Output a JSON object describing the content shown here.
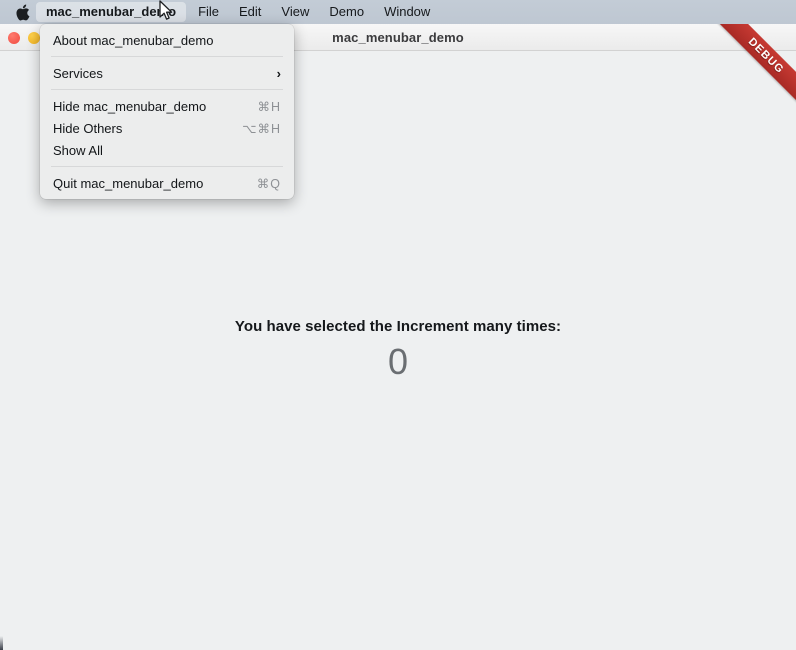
{
  "menubar": {
    "apple_icon": "apple-logo-icon",
    "app_name": "mac_menubar_demo",
    "items": [
      "File",
      "Edit",
      "View",
      "Demo",
      "Window"
    ]
  },
  "window": {
    "title": "mac_menubar_demo",
    "traffic_lights": [
      "close",
      "minimize",
      "zoom"
    ]
  },
  "debug_banner": {
    "label": "DEBUG",
    "color": "#b8322c"
  },
  "content": {
    "counter_label": "You have selected the Increment many times:",
    "counter_value": "0"
  },
  "app_menu": {
    "groups": [
      {
        "items": [
          {
            "label": "About mac_menubar_demo",
            "accel": "",
            "submenu": false
          }
        ]
      },
      {
        "items": [
          {
            "label": "Services",
            "accel": "",
            "submenu": true,
            "chevron": "›"
          }
        ]
      },
      {
        "items": [
          {
            "label": "Hide mac_menubar_demo",
            "accel": "⌘H",
            "submenu": false
          },
          {
            "label": "Hide Others",
            "accel": "⌥⌘H",
            "submenu": false
          },
          {
            "label": "Show All",
            "accel": "",
            "submenu": false
          }
        ]
      },
      {
        "items": [
          {
            "label": "Quit mac_menubar_demo",
            "accel": "⌘Q",
            "submenu": false
          }
        ]
      }
    ]
  },
  "cursor": {
    "type": "arrow-pointer"
  }
}
